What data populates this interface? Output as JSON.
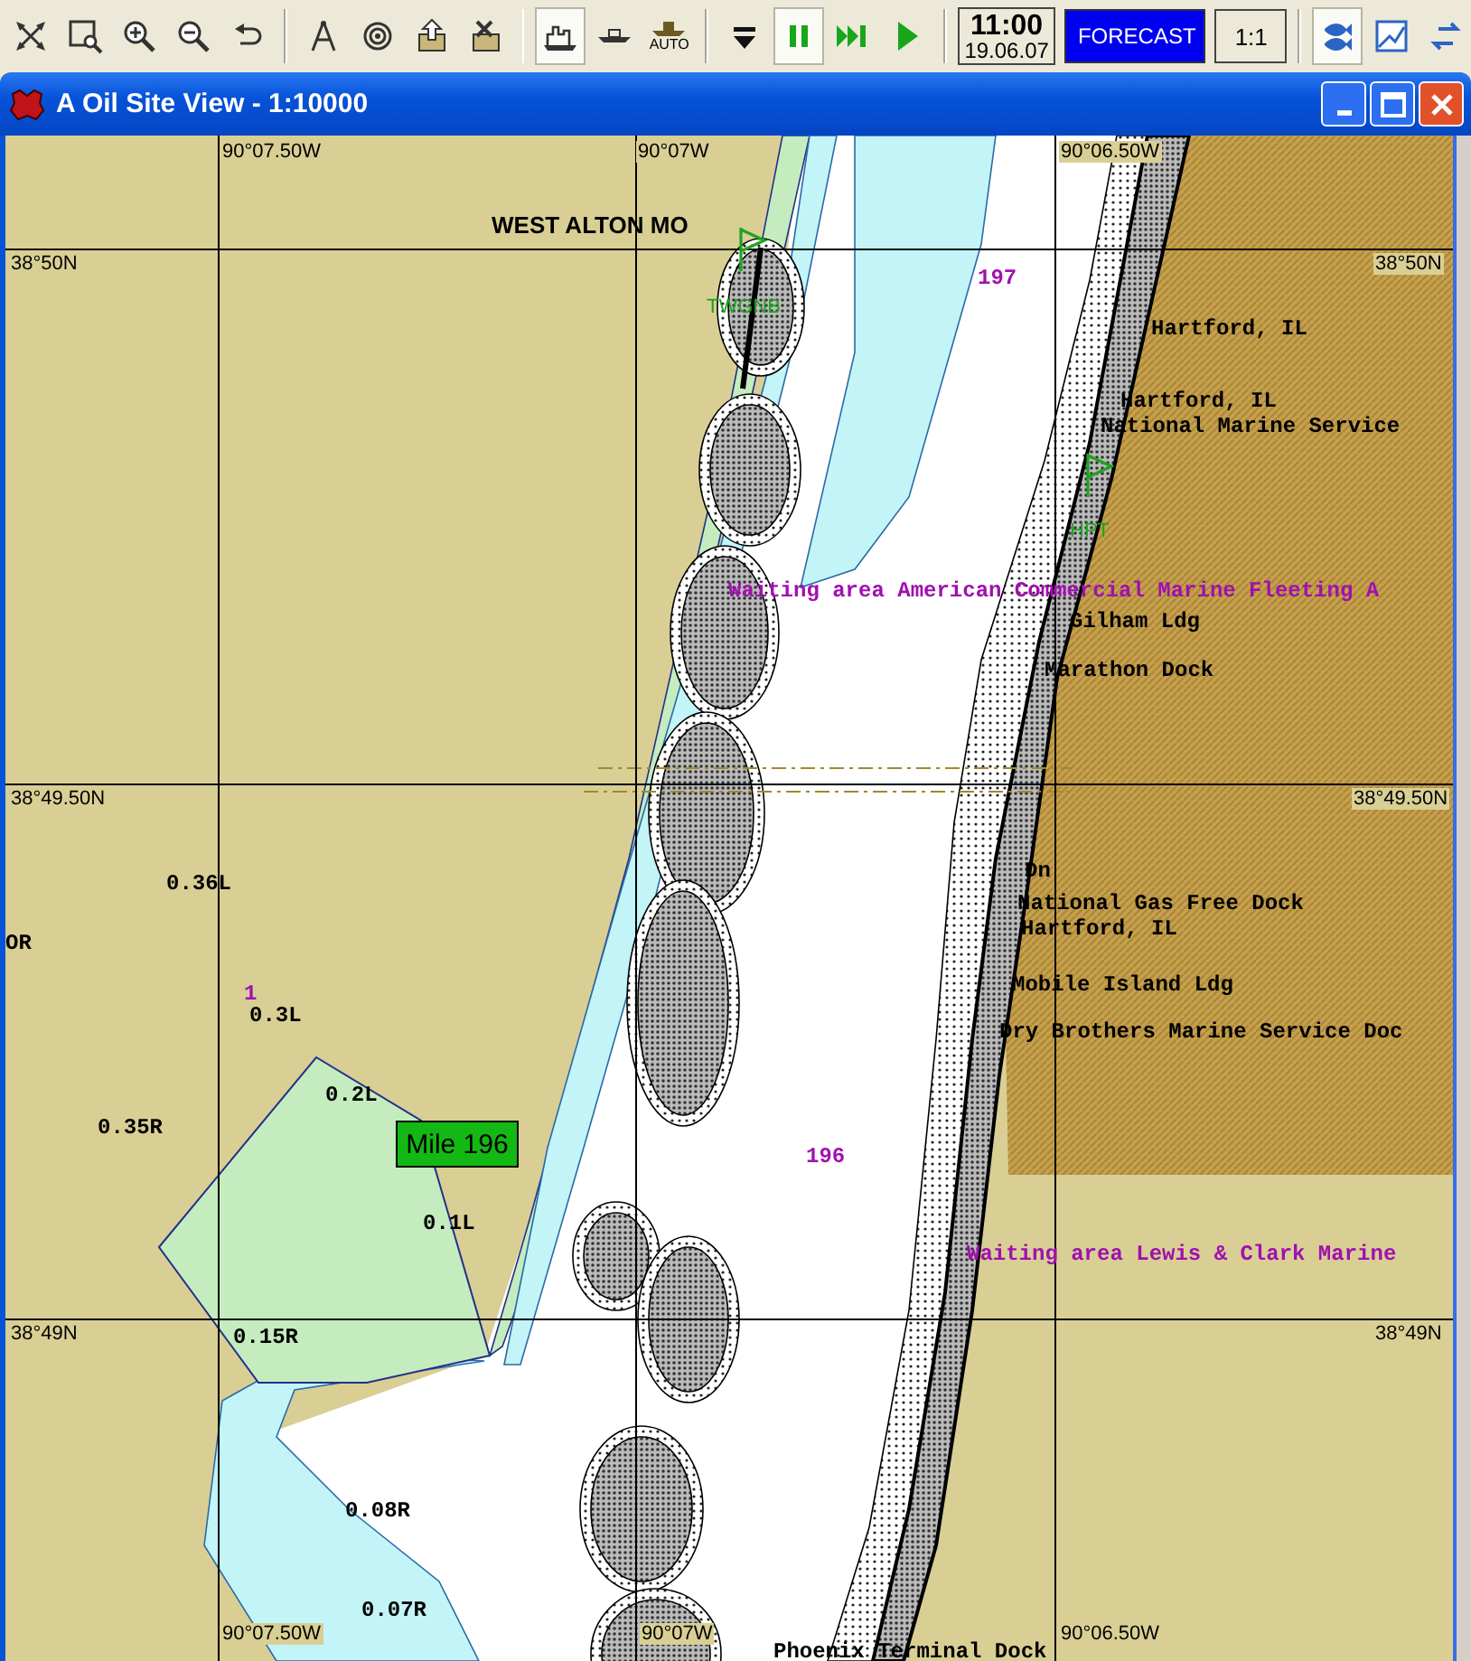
{
  "toolbar": {
    "left_buttons": [
      {
        "selected": false
      },
      {
        "selected": false
      },
      {
        "selected": false
      },
      {
        "selected": false
      },
      {
        "selected": false
      },
      {
        "selected": false
      },
      {
        "selected": false
      },
      {
        "selected": false
      },
      {
        "selected": false
      },
      {
        "selected": true
      },
      {
        "selected": false
      },
      {
        "selected": false,
        "label": "AUTO"
      },
      {
        "selected": false
      },
      {
        "selected": true
      },
      {
        "selected": false
      },
      {
        "selected": false
      }
    ],
    "clock": {
      "time": "11:00",
      "date": "19.06.07"
    },
    "forecast": "FORECAST",
    "scale": "1:1",
    "right_buttons": [
      {
        "selected": true
      },
      {
        "selected": false
      },
      {
        "selected": false
      }
    ]
  },
  "window": {
    "title": "A Oil Site View - 1:10000"
  },
  "chart": {
    "labels": [
      {
        "kind": "coord",
        "text": "90°07.50W"
      },
      {
        "kind": "coord",
        "text": "90°07W"
      },
      {
        "kind": "coord",
        "text": "90°06.50W"
      },
      {
        "kind": "town",
        "text": "WEST ALTON MO"
      },
      {
        "kind": "coord",
        "text": "38°50N"
      },
      {
        "kind": "mile",
        "text": "197"
      },
      {
        "kind": "coord",
        "text": "38°50N"
      },
      {
        "kind": "station",
        "text": "TWGNB"
      },
      {
        "kind": "place",
        "text": "Hartford, IL"
      },
      {
        "kind": "place",
        "text": "Hartford, IL"
      },
      {
        "kind": "place",
        "text": "National Marine Service"
      },
      {
        "kind": "station",
        "text": "HPT"
      },
      {
        "kind": "area",
        "text": "Waiting area American Commercial Marine Fleeting A"
      },
      {
        "kind": "place",
        "text": "Gilham Ldg"
      },
      {
        "kind": "place",
        "text": "Marathon Dock"
      },
      {
        "kind": "coord",
        "text": "38°49.50N"
      },
      {
        "kind": "coord",
        "text": "38°49.50N"
      },
      {
        "kind": "place",
        "text": "Dn"
      },
      {
        "kind": "depth",
        "text": "0.36L"
      },
      {
        "kind": "place",
        "text": "National Gas Free Dock"
      },
      {
        "kind": "place",
        "text": "Hartford, IL"
      },
      {
        "kind": "depth",
        "text": "OR"
      },
      {
        "kind": "mile",
        "text": "1"
      },
      {
        "kind": "place",
        "text": "Mobile Island Ldg"
      },
      {
        "kind": "depth",
        "text": "0.3L"
      },
      {
        "kind": "place",
        "text": "Dry Brothers Marine Service Doc"
      },
      {
        "kind": "depth",
        "text": "0.2L"
      },
      {
        "kind": "depth",
        "text": "0.35R"
      },
      {
        "kind": "mile",
        "text": "196"
      },
      {
        "kind": "depth",
        "text": "0.1L"
      },
      {
        "kind": "area",
        "text": "Waiting area Lewis & Clark Marine"
      },
      {
        "kind": "coord",
        "text": "38°49N"
      },
      {
        "kind": "depth",
        "text": "0.15R"
      },
      {
        "kind": "coord",
        "text": "38°49N"
      },
      {
        "kind": "depth",
        "text": "0.08R"
      },
      {
        "kind": "depth",
        "text": "0.07R"
      },
      {
        "kind": "coord",
        "text": "90°07.50W"
      },
      {
        "kind": "coord",
        "text": "90°07W"
      },
      {
        "kind": "coord",
        "text": "90°06.50W"
      },
      {
        "kind": "place",
        "text": "Phoenix Terminal Dock"
      }
    ],
    "mile_marker": "Mile 196"
  }
}
